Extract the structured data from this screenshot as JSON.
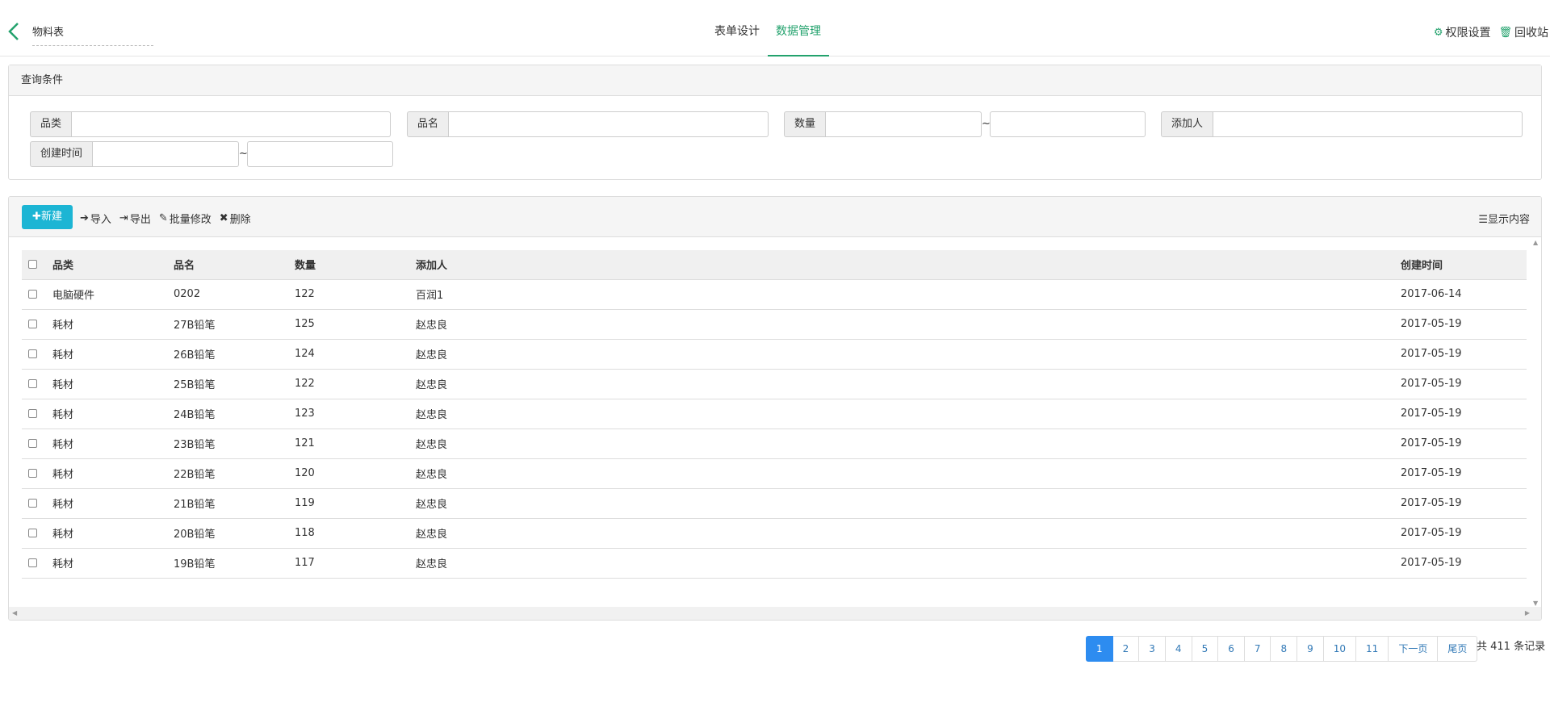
{
  "header": {
    "form_title": "物料表",
    "tabs": [
      {
        "label": "表单设计"
      },
      {
        "label": "数据管理"
      }
    ],
    "actions": {
      "permissions": "权限设置",
      "recycle": "回收站"
    }
  },
  "query": {
    "title": "查询条件",
    "fields": {
      "category": "品类",
      "name": "品名",
      "quantity": "数量",
      "adder": "添加人",
      "created": "创建时间"
    },
    "range_sep": "~"
  },
  "toolbar": {
    "new": "新建",
    "import": "导入",
    "export": "导出",
    "batch_edit": "批量修改",
    "delete": "删除",
    "display": "显示内容"
  },
  "table": {
    "columns": [
      "品类",
      "品名",
      "数量",
      "添加人",
      "创建时间"
    ],
    "rows": [
      [
        "电脑硬件",
        "0202",
        "122",
        "百润1",
        "2017-06-14"
      ],
      [
        "耗材",
        "27B铅笔",
        "125",
        "赵忠良",
        "2017-05-19"
      ],
      [
        "耗材",
        "26B铅笔",
        "124",
        "赵忠良",
        "2017-05-19"
      ],
      [
        "耗材",
        "25B铅笔",
        "122",
        "赵忠良",
        "2017-05-19"
      ],
      [
        "耗材",
        "24B铅笔",
        "123",
        "赵忠良",
        "2017-05-19"
      ],
      [
        "耗材",
        "23B铅笔",
        "121",
        "赵忠良",
        "2017-05-19"
      ],
      [
        "耗材",
        "22B铅笔",
        "120",
        "赵忠良",
        "2017-05-19"
      ],
      [
        "耗材",
        "21B铅笔",
        "119",
        "赵忠良",
        "2017-05-19"
      ],
      [
        "耗材",
        "20B铅笔",
        "118",
        "赵忠良",
        "2017-05-19"
      ],
      [
        "耗材",
        "19B铅笔",
        "117",
        "赵忠良",
        "2017-05-19"
      ]
    ]
  },
  "pagination": {
    "pages": [
      "1",
      "2",
      "3",
      "4",
      "5",
      "6",
      "7",
      "8",
      "9",
      "10",
      "11"
    ],
    "current": "1",
    "next": "下一页",
    "last": "尾页",
    "total": "共 411 条记录"
  },
  "colors": {
    "accent": "#23a26d",
    "primary_button": "#1cb5d4",
    "page_active": "#2d8cf0"
  }
}
